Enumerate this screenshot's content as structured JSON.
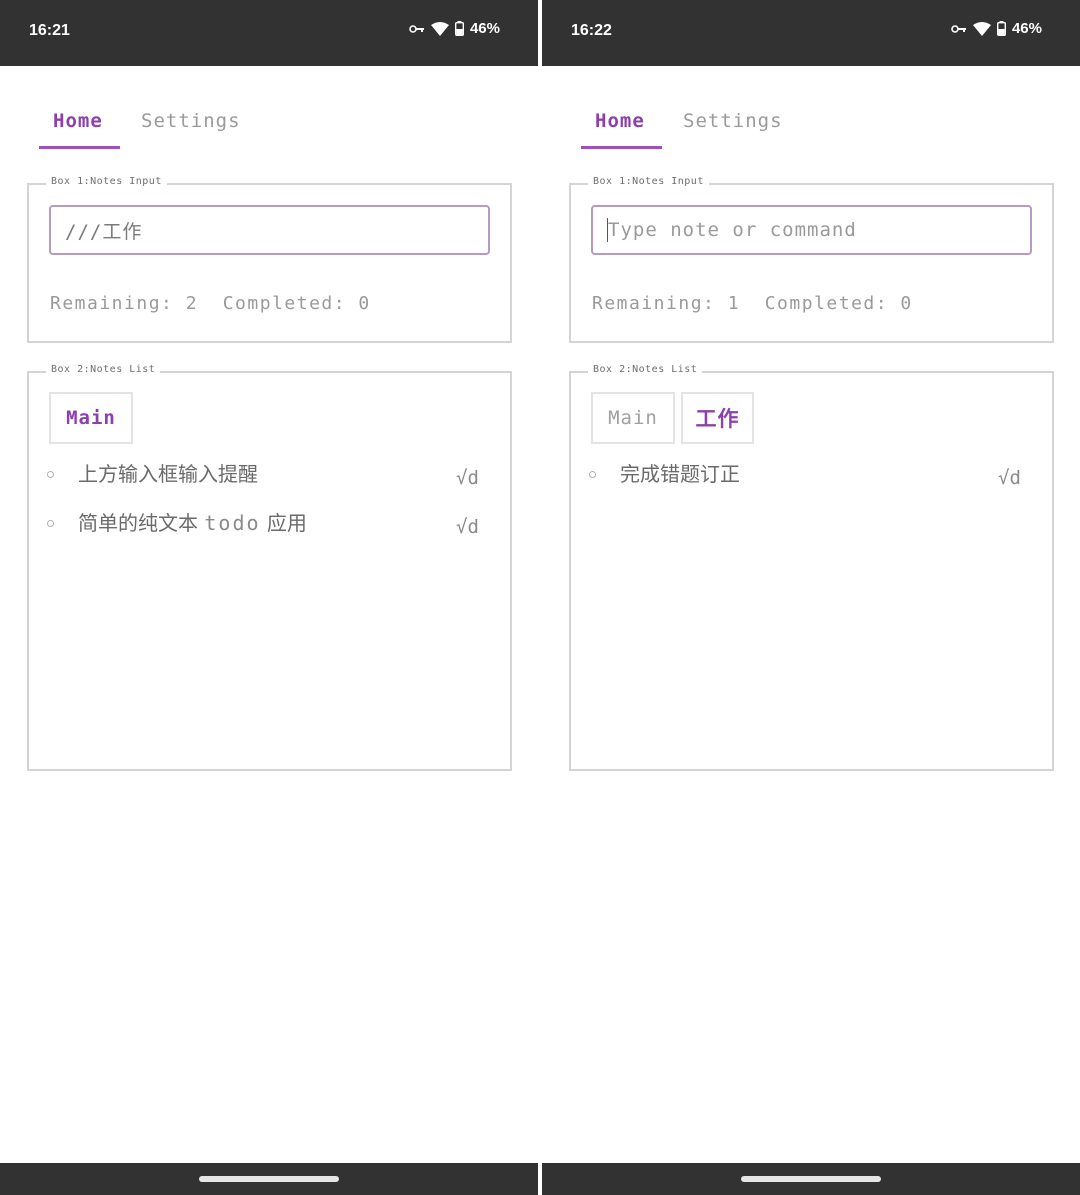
{
  "screens": [
    {
      "status": {
        "time": "16:21",
        "battery": "46%"
      },
      "tabs": {
        "home": "Home",
        "settings": "Settings"
      },
      "box1": {
        "legend": "Box 1:Notes Input",
        "input_value": "///工作",
        "placeholder": "",
        "counters": "Remaining: 2  Completed: 0"
      },
      "box2": {
        "legend": "Box 2:Notes List",
        "categories": [
          "Main"
        ],
        "notes": [
          {
            "text": "上方输入框输入提醒",
            "done_label": "√d"
          },
          {
            "pre": "简单的纯文本 ",
            "mono": "todo",
            "post": " 应用",
            "done_label": "√d"
          }
        ]
      }
    },
    {
      "status": {
        "time": "16:22",
        "battery": "46%"
      },
      "tabs": {
        "home": "Home",
        "settings": "Settings"
      },
      "box1": {
        "legend": "Box 1:Notes Input",
        "input_value": "",
        "placeholder": "Type note or command",
        "counters": "Remaining: 1  Completed: 0"
      },
      "box2": {
        "legend": "Box 2:Notes List",
        "categories": [
          "Main",
          "工作"
        ],
        "notes": [
          {
            "text": "完成错题订正",
            "done_label": "√d"
          }
        ]
      }
    }
  ],
  "colors": {
    "accent": "#8e3fae",
    "underline": "#9c52be",
    "statusbar": "#323232",
    "border": "#d4d4d4",
    "input_border": "#b79ac4"
  },
  "icons": [
    "vpn-key-icon",
    "wifi-icon",
    "battery-icon"
  ]
}
